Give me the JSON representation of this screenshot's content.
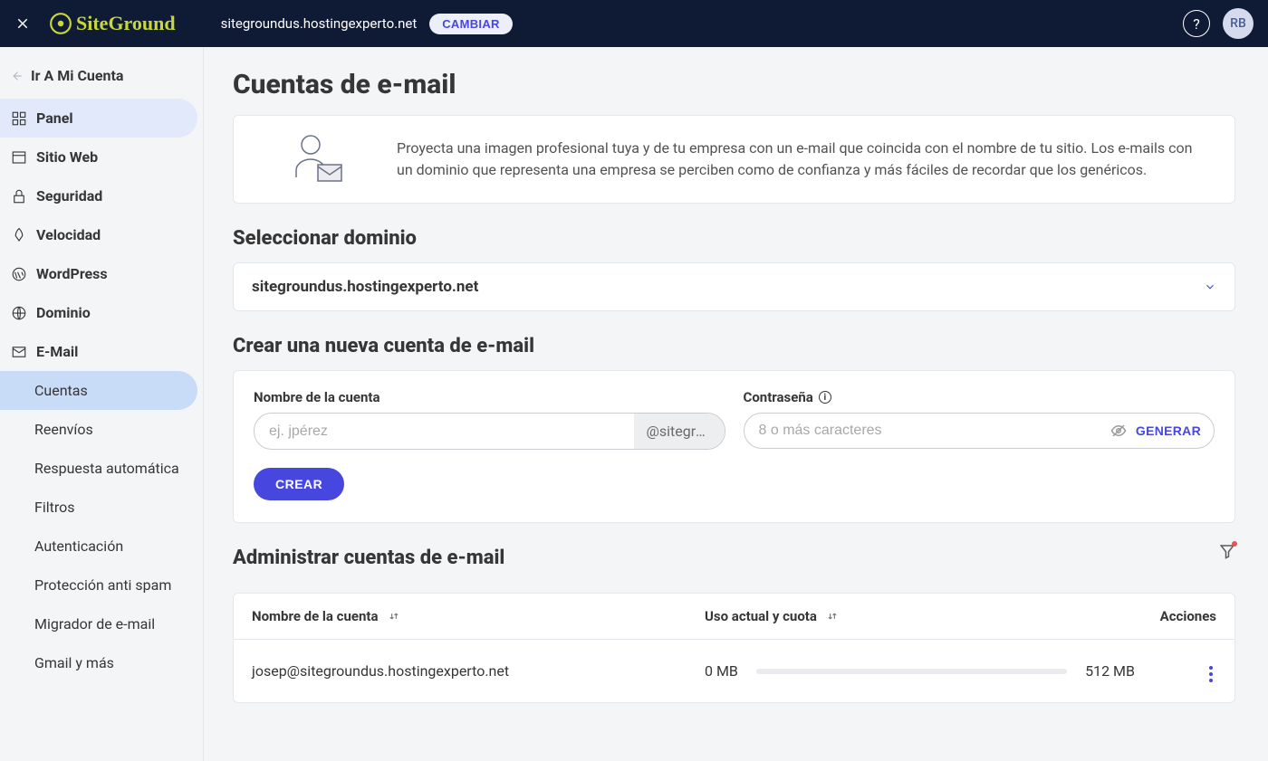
{
  "header": {
    "logo": "SiteGround",
    "domain": "sitegroundus.hostingexperto.net",
    "change_label": "CAMBIAR",
    "avatar_initials": "RB"
  },
  "sidebar": {
    "back_label": "Ir A Mi Cuenta",
    "items": {
      "panel": "Panel",
      "website": "Sitio Web",
      "security": "Seguridad",
      "speed": "Velocidad",
      "wordpress": "WordPress",
      "domain": "Dominio",
      "email": "E-Mail"
    },
    "email_sub": {
      "accounts": "Cuentas",
      "forwards": "Reenvíos",
      "autoresponder": "Respuesta automática",
      "filters": "Filtros",
      "auth": "Autenticación",
      "spam": "Protección anti spam",
      "migrator": "Migrador de e-mail",
      "gmail": "Gmail y más"
    }
  },
  "page": {
    "title": "Cuentas de e-mail",
    "intro_text": "Proyecta una imagen profesional tuya y de tu empresa con un e-mail que coincida con el nombre de tu sitio. Los e-mails con un dominio que representa una empresa se perciben como de confianza y más fáciles de recordar que los genéricos.",
    "select_domain_heading": "Seleccionar dominio",
    "selected_domain": "sitegroundus.hostingexperto.net",
    "create_heading": "Crear una nueva cuenta de e-mail",
    "account_label": "Nombre de la cuenta",
    "account_placeholder": "ej. jpérez",
    "account_suffix": "@sitegro...",
    "password_label": "Contraseña",
    "password_placeholder": "8 o más caracteres",
    "generate_label": "GENERAR",
    "create_btn": "CREAR",
    "manage_heading": "Administrar cuentas de e-mail",
    "table": {
      "col_name": "Nombre de la cuenta",
      "col_usage": "Uso actual y cuota",
      "col_actions": "Acciones",
      "rows": [
        {
          "name": "josep@sitegroundus.hostingexperto.net",
          "used": "0 MB",
          "quota": "512 MB"
        }
      ]
    }
  }
}
